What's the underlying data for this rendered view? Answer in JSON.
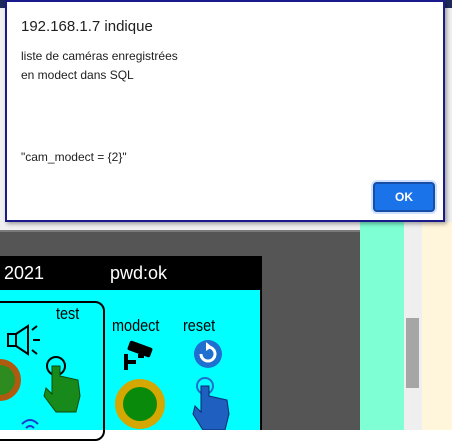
{
  "dialog": {
    "title": "192.168.1.7 indique",
    "message_lines": [
      "liste de caméras enregistrées",
      "en modect dans SQL",
      "\"cam_modect = {2}\""
    ],
    "ok_label": "OK"
  },
  "panel": {
    "header_year": "2021",
    "header_pwd": "pwd:ok",
    "labels": {
      "test": "test",
      "modect": "modect",
      "reset": "reset"
    },
    "icons": [
      "speaker-icon",
      "hand-press-icon",
      "camera-icon",
      "reset-icon",
      "wifi-icon"
    ]
  },
  "colors": {
    "panel_bg": "#00ffff",
    "ok_button": "#1a73e8",
    "mint": "#7fffd4",
    "dialog_border": "#1a1a8c"
  }
}
